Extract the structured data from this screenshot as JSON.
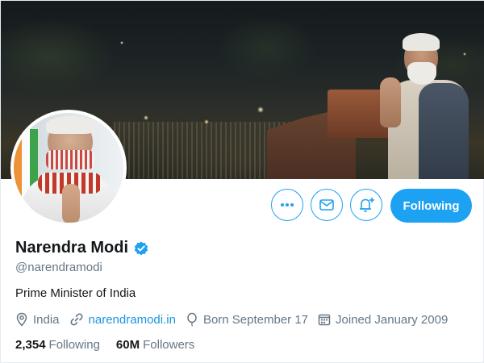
{
  "colors": {
    "accent": "#1da1f2",
    "link": "#1b95e0",
    "secondary_text": "#657786",
    "primary_text": "#14171a"
  },
  "profile": {
    "name": "Narendra Modi",
    "handle": "@narendramodi",
    "verified": true,
    "bio": "Prime Minister of India",
    "location": "India",
    "website": "narendramodi.in",
    "born": "Born September 17",
    "joined": "Joined January 2009"
  },
  "actions": {
    "more_icon": "more-icon",
    "message_icon": "envelope-icon",
    "notify_icon": "bell-plus-icon",
    "follow_label": "Following"
  },
  "stats": {
    "following_count": "2,354",
    "following_label": "Following",
    "followers_count": "60M",
    "followers_label": "Followers"
  }
}
